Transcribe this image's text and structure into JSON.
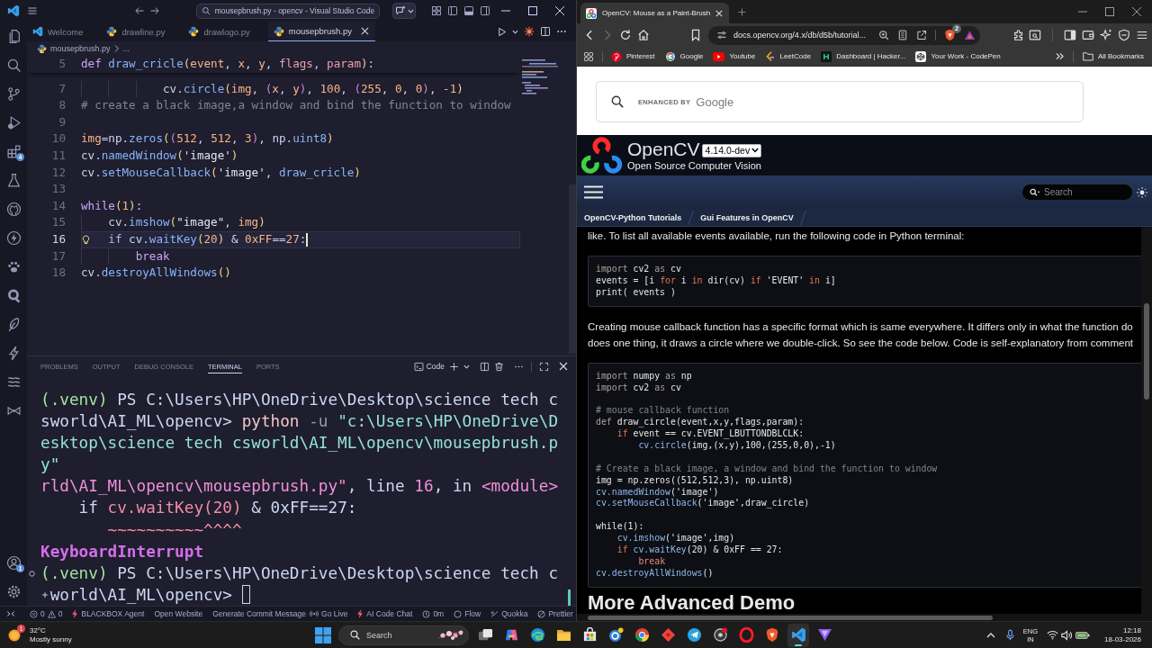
{
  "vscode": {
    "title_bar": {
      "title": "mousepbrush.py - opencv - Visual Studio Code"
    },
    "activity_bar": {
      "extensions_badge": "4",
      "accounts_badge": "1"
    },
    "tabs": [
      {
        "label": "Welcome",
        "kind": "welcome",
        "selected": false
      },
      {
        "label": "drawline.py",
        "kind": "python",
        "selected": false
      },
      {
        "label": "drawlogo.py",
        "kind": "python",
        "selected": false
      },
      {
        "label": "mousepbrush.py",
        "kind": "python",
        "selected": true
      }
    ],
    "breadcrumb": {
      "file": "mousepbrush.py",
      "more": "..."
    },
    "editor": {
      "sticky_line": {
        "number": "5",
        "tokens": [
          {
            "kind": "keyword",
            "text": "def "
          },
          {
            "kind": "function",
            "text": "draw_cricle"
          },
          {
            "kind": "bracket",
            "text": "("
          },
          {
            "kind": "variable",
            "text": "event"
          },
          {
            "kind": "plain",
            "text": ", "
          },
          {
            "kind": "variable",
            "text": "x"
          },
          {
            "kind": "plain",
            "text": ", "
          },
          {
            "kind": "variable",
            "text": "y"
          },
          {
            "kind": "plain",
            "text": ", "
          },
          {
            "kind": "parameter",
            "text": "flags"
          },
          {
            "kind": "plain",
            "text": ", "
          },
          {
            "kind": "parameter",
            "text": "param"
          },
          {
            "kind": "bracket",
            "text": ")"
          },
          {
            "kind": "plain",
            "text": ":"
          }
        ]
      },
      "lines": [
        {
          "number": "7",
          "current": false,
          "tokens": [
            {
              "kind": "plain",
              "text": "            cv."
            },
            {
              "kind": "function",
              "text": "circle"
            },
            {
              "kind": "bracket",
              "text": "("
            },
            {
              "kind": "variable",
              "text": "img"
            },
            {
              "kind": "plain",
              "text": ", "
            },
            {
              "kind": "bracket2",
              "text": "("
            },
            {
              "kind": "variable",
              "text": "x"
            },
            {
              "kind": "plain",
              "text": ", "
            },
            {
              "kind": "variable",
              "text": "y"
            },
            {
              "kind": "bracket2",
              "text": ")"
            },
            {
              "kind": "plain",
              "text": ", "
            },
            {
              "kind": "number",
              "text": "100"
            },
            {
              "kind": "plain",
              "text": ", "
            },
            {
              "kind": "bracket2",
              "text": "("
            },
            {
              "kind": "number",
              "text": "255"
            },
            {
              "kind": "plain",
              "text": ", "
            },
            {
              "kind": "number",
              "text": "0"
            },
            {
              "kind": "plain",
              "text": ", "
            },
            {
              "kind": "number",
              "text": "0"
            },
            {
              "kind": "bracket2",
              "text": ")"
            },
            {
              "kind": "plain",
              "text": ", "
            },
            {
              "kind": "number",
              "text": "-1"
            },
            {
              "kind": "bracket",
              "text": ")"
            }
          ]
        },
        {
          "number": "8",
          "current": false,
          "tokens": [
            {
              "kind": "comment",
              "text": "# create a black image,a window and bind the function to window"
            }
          ]
        },
        {
          "number": "9",
          "current": false
        },
        {
          "number": "10",
          "current": false,
          "tokens": [
            {
              "kind": "variable",
              "text": "img"
            },
            {
              "kind": "plain",
              "text": "=np."
            },
            {
              "kind": "function",
              "text": "zeros"
            },
            {
              "kind": "bracket",
              "text": "("
            },
            {
              "kind": "bracket2",
              "text": "("
            },
            {
              "kind": "number",
              "text": "512"
            },
            {
              "kind": "plain",
              "text": ", "
            },
            {
              "kind": "number",
              "text": "512"
            },
            {
              "kind": "plain",
              "text": ", "
            },
            {
              "kind": "number",
              "text": "3"
            },
            {
              "kind": "bracket2",
              "text": ")"
            },
            {
              "kind": "plain",
              "text": ", np."
            },
            {
              "kind": "function",
              "text": "uint8"
            },
            {
              "kind": "bracket",
              "text": ")"
            }
          ]
        },
        {
          "number": "11",
          "current": false,
          "tokens": [
            {
              "kind": "plain",
              "text": "cv."
            },
            {
              "kind": "function",
              "text": "namedWindow"
            },
            {
              "kind": "bracket",
              "text": "("
            },
            {
              "kind": "string",
              "text": "'image'"
            },
            {
              "kind": "bracket",
              "text": ")"
            }
          ]
        },
        {
          "number": "12",
          "current": false,
          "tokens": [
            {
              "kind": "plain",
              "text": "cv."
            },
            {
              "kind": "function",
              "text": "setMouseCallback"
            },
            {
              "kind": "bracket",
              "text": "("
            },
            {
              "kind": "string",
              "text": "'image'"
            },
            {
              "kind": "plain",
              "text": ", "
            },
            {
              "kind": "function",
              "text": "draw_cricle"
            },
            {
              "kind": "bracket",
              "text": ")"
            }
          ]
        },
        {
          "number": "13",
          "current": false
        },
        {
          "number": "14",
          "current": false,
          "tokens": [
            {
              "kind": "keyword",
              "text": "while"
            },
            {
              "kind": "bracket",
              "text": "("
            },
            {
              "kind": "number",
              "text": "1"
            },
            {
              "kind": "bracket",
              "text": ")"
            },
            {
              "kind": "plain",
              "text": ":"
            }
          ]
        },
        {
          "number": "15",
          "current": false,
          "tokens": [
            {
              "kind": "plain",
              "text": "    cv."
            },
            {
              "kind": "function",
              "text": "imshow"
            },
            {
              "kind": "bracket",
              "text": "("
            },
            {
              "kind": "string",
              "text": "\"image\""
            },
            {
              "kind": "plain",
              "text": ", "
            },
            {
              "kind": "variable",
              "text": "img"
            },
            {
              "kind": "bracket",
              "text": ")"
            }
          ]
        },
        {
          "number": "16",
          "current": true,
          "tokens": [
            {
              "kind": "keyword",
              "text": "    if"
            },
            {
              "kind": "plain",
              "text": " cv."
            },
            {
              "kind": "function",
              "text": "waitKey"
            },
            {
              "kind": "bracket",
              "text": "("
            },
            {
              "kind": "number",
              "text": "20"
            },
            {
              "kind": "bracket",
              "text": ")"
            },
            {
              "kind": "plain",
              "text": " & "
            },
            {
              "kind": "number",
              "text": "0xFF"
            },
            {
              "kind": "plain",
              "text": "=="
            },
            {
              "kind": "number",
              "text": "27"
            },
            {
              "kind": "plain",
              "text": ":"
            }
          ]
        },
        {
          "number": "17",
          "current": false,
          "tokens": [
            {
              "kind": "keyword",
              "text": "        break"
            }
          ]
        },
        {
          "number": "18",
          "current": false,
          "tokens": [
            {
              "kind": "plain",
              "text": "cv."
            },
            {
              "kind": "function",
              "text": "destroyAllWindows"
            },
            {
              "kind": "bracket",
              "text": "()"
            }
          ]
        }
      ]
    },
    "panel": {
      "tabs": [
        {
          "label": "PROBLEMS",
          "selected": false
        },
        {
          "label": "OUTPUT",
          "selected": false
        },
        {
          "label": "DEBUG CONSOLE",
          "selected": false
        },
        {
          "label": "TERMINAL",
          "selected": true
        },
        {
          "label": "PORTS",
          "selected": false
        }
      ],
      "terminal_profile": "Code",
      "terminal_lines": [
        {
          "kind": "output",
          "tokens": [
            {
              "kind": "venv",
              "text": "(.venv)"
            },
            {
              "kind": "plain",
              "text": " PS C:\\Users\\HP\\OneDrive\\Desktop\\science tech c"
            }
          ]
        },
        {
          "kind": "output",
          "tokens": [
            {
              "kind": "plain",
              "text": "sworld\\AI_ML\\opencv> "
            },
            {
              "kind": "command",
              "text": "python"
            },
            {
              "kind": "flag",
              "text": " -u "
            },
            {
              "kind": "string",
              "text": "\"c:\\Users\\HP\\OneDrive\\D"
            }
          ]
        },
        {
          "kind": "output",
          "tokens": [
            {
              "kind": "string",
              "text": "esktop\\science tech csworld\\AI_ML\\opencv\\mousepbrush.p"
            }
          ]
        },
        {
          "kind": "output",
          "tokens": [
            {
              "kind": "string",
              "text": "y\""
            }
          ]
        },
        {
          "kind": "output",
          "tokens": [
            {
              "kind": "location",
              "text": "rld\\AI_ML\\opencv\\mousepbrush.py\""
            },
            {
              "kind": "plain",
              "text": ", line "
            },
            {
              "kind": "location",
              "text": "16"
            },
            {
              "kind": "plain",
              "text": ", in "
            },
            {
              "kind": "location",
              "text": "<module>"
            }
          ]
        },
        {
          "kind": "output",
          "tokens": [
            {
              "kind": "plain",
              "text": "    if "
            },
            {
              "kind": "error",
              "text": "cv.waitKey(20)"
            },
            {
              "kind": "plain",
              "text": " & 0xFF==27:"
            }
          ]
        },
        {
          "kind": "output",
          "tokens": [
            {
              "kind": "error",
              "text": "       ~~~~~~~~~~^^^^"
            }
          ]
        },
        {
          "kind": "output",
          "tokens": [
            {
              "kind": "exception",
              "text": "KeyboardInterrupt"
            }
          ]
        },
        {
          "kind": "finished_command",
          "tokens": [
            {
              "kind": "venv",
              "text": "(.venv)"
            },
            {
              "kind": "plain",
              "text": " PS C:\\Users\\HP\\OneDrive\\Desktop\\science tech c"
            }
          ]
        },
        {
          "kind": "active_prompt",
          "tokens": [
            {
              "kind": "plain",
              "text": "world\\AI_ML\\opencv> "
            }
          ]
        }
      ]
    },
    "status_bar": {
      "left": [
        {
          "kind": "remote"
        },
        {
          "kind": "problems",
          "errors": "0",
          "warnings": "0"
        },
        {
          "kind": "agent",
          "label": "BLACKBOX Agent"
        },
        {
          "kind": "text",
          "label": "Open Website"
        },
        {
          "kind": "text",
          "label": "Generate Commit Message"
        }
      ],
      "right": [
        {
          "kind": "live",
          "label": "Go Live"
        },
        {
          "kind": "agent",
          "label": "AI Code Chat"
        },
        {
          "kind": "timer",
          "label": "0m"
        },
        {
          "kind": "flow",
          "label": "Flow"
        },
        {
          "kind": "quokka",
          "label": "Quokka"
        },
        {
          "kind": "prettier",
          "label": "Prettier"
        }
      ]
    }
  },
  "browser": {
    "tabs": [
      {
        "title": "OpenCV: Mouse as a Paint-Brush",
        "selected": true
      }
    ],
    "address_bar": {
      "url": "docs.opencv.org/4.x/db/d5b/tutorial...",
      "shields_badge": "2"
    },
    "bookmarks": [
      {
        "label": "Pinterest",
        "kind": "pinterest"
      },
      {
        "label": "Google",
        "kind": "google"
      },
      {
        "label": "Youtube",
        "kind": "youtube"
      },
      {
        "label": "LeetCode",
        "kind": "leetcode"
      },
      {
        "label": "Dashboard | Hacker...",
        "kind": "hackerrank"
      },
      {
        "label": "Your Work - CodePen",
        "kind": "codepen"
      }
    ],
    "all_bookmarks": "All Bookmarks",
    "page": {
      "site_search": {
        "label": "ENHANCED BY",
        "brand": "Google"
      },
      "header": {
        "title": "OpenCV",
        "version": "4.14.0-dev",
        "subtitle": "Open Source Computer Vision"
      },
      "nav_search": {
        "placeholder": "Search"
      },
      "breadcrumbs": [
        "OpenCV-Python Tutorials",
        "Gui Features in OpenCV"
      ],
      "content": [
        {
          "kind": "paragraph",
          "lines": [
            "like. To list all available events available, run the following code in Python terminal:"
          ]
        },
        {
          "kind": "code",
          "groups": [
            [
              [
                {
                  "kind": "keyword",
                  "text": "import"
                },
                {
                  "kind": "plain",
                  "text": " cv2 "
                },
                {
                  "kind": "keyword",
                  "text": "as"
                },
                {
                  "kind": "plain",
                  "text": " cv"
                }
              ],
              [
                {
                  "kind": "plain",
                  "text": "events = [i "
                },
                {
                  "kind": "control",
                  "text": "for"
                },
                {
                  "kind": "plain",
                  "text": " i "
                },
                {
                  "kind": "control",
                  "text": "in"
                },
                {
                  "kind": "plain",
                  "text": " dir(cv) "
                },
                {
                  "kind": "control",
                  "text": "if"
                },
                {
                  "kind": "plain",
                  "text": " 'EVENT' "
                },
                {
                  "kind": "control",
                  "text": "in"
                },
                {
                  "kind": "plain",
                  "text": " i]"
                }
              ],
              [
                {
                  "kind": "plain",
                  "text": "print( events )"
                }
              ]
            ]
          ]
        },
        {
          "kind": "paragraph",
          "lines": [
            "Creating mouse callback function has a specific format which is same everywhere. It differs only in what the function do",
            "does one thing, it draws a circle where we double-click. So see the code below. Code is self-explanatory from comment"
          ]
        },
        {
          "kind": "code",
          "groups": [
            [
              [
                {
                  "kind": "keyword",
                  "text": "import"
                },
                {
                  "kind": "plain",
                  "text": " numpy "
                },
                {
                  "kind": "keyword",
                  "text": "as"
                },
                {
                  "kind": "plain",
                  "text": " np"
                }
              ],
              [
                {
                  "kind": "keyword",
                  "text": "import"
                },
                {
                  "kind": "plain",
                  "text": " cv2 "
                },
                {
                  "kind": "keyword",
                  "text": "as"
                },
                {
                  "kind": "plain",
                  "text": " cv"
                }
              ]
            ],
            [
              [
                {
                  "kind": "comment",
                  "text": "# mouse callback function"
                }
              ],
              [
                {
                  "kind": "keyword",
                  "text": "def"
                },
                {
                  "kind": "plain",
                  "text": " draw_circle(event,x,y,flags,param):"
                }
              ],
              [
                {
                  "kind": "control",
                  "text": "    if"
                },
                {
                  "kind": "plain",
                  "text": " event == cv.EVENT_LBUTTONDBLCLK:"
                }
              ],
              [
                {
                  "kind": "function",
                  "text": "        cv.circle"
                },
                {
                  "kind": "plain",
                  "text": "(img,(x,y),100,(255,0,0),-1)"
                }
              ]
            ],
            [
              [
                {
                  "kind": "comment",
                  "text": "# Create a black image, a window and bind the function to window"
                }
              ],
              [
                {
                  "kind": "plain",
                  "text": "img = np.zeros((512,512,3), np.uint8)"
                }
              ],
              [
                {
                  "kind": "function",
                  "text": "cv.namedWindow"
                },
                {
                  "kind": "plain",
                  "text": "('image')"
                }
              ],
              [
                {
                  "kind": "function",
                  "text": "cv.setMouseCallback"
                },
                {
                  "kind": "plain",
                  "text": "('image',draw_circle)"
                }
              ]
            ],
            [
              [
                {
                  "kind": "plain",
                  "text": "while(1):"
                }
              ],
              [
                {
                  "kind": "function",
                  "text": "    cv.imshow"
                },
                {
                  "kind": "plain",
                  "text": "('image',img)"
                }
              ],
              [
                {
                  "kind": "control",
                  "text": "    if "
                },
                {
                  "kind": "function",
                  "text": "cv.waitKey"
                },
                {
                  "kind": "plain",
                  "text": "(20) & 0xFF == 27:"
                }
              ],
              [
                {
                  "kind": "break",
                  "text": "        break"
                }
              ],
              [
                {
                  "kind": "function",
                  "text": "cv.destroyAllWindows"
                },
                {
                  "kind": "plain",
                  "text": "()"
                }
              ]
            ]
          ]
        },
        {
          "kind": "heading",
          "text": "More Advanced Demo"
        }
      ]
    }
  },
  "taskbar": {
    "weather": {
      "badge": "1",
      "temperature": "32°C",
      "condition": "Mostly sunny"
    },
    "search": {
      "placeholder": "Search"
    },
    "apps": [
      {
        "kind": "task_view",
        "active": false
      },
      {
        "kind": "copilot",
        "active": false
      },
      {
        "kind": "edge",
        "active": false
      },
      {
        "kind": "explorer",
        "active": false
      },
      {
        "kind": "store",
        "active": false
      },
      {
        "kind": "help",
        "active": false
      },
      {
        "kind": "chrome",
        "active": false
      },
      {
        "kind": "anydesk",
        "active": false
      },
      {
        "kind": "telegram",
        "active": false
      },
      {
        "kind": "recorder",
        "active": false
      },
      {
        "kind": "opera",
        "active": false
      },
      {
        "kind": "brave",
        "active": false
      },
      {
        "kind": "vscode",
        "active": true
      },
      {
        "kind": "proton",
        "active": false
      }
    ],
    "tray": {
      "language": "ENG",
      "region": "IN",
      "time": "12:18",
      "date": "18-03-2026"
    }
  }
}
